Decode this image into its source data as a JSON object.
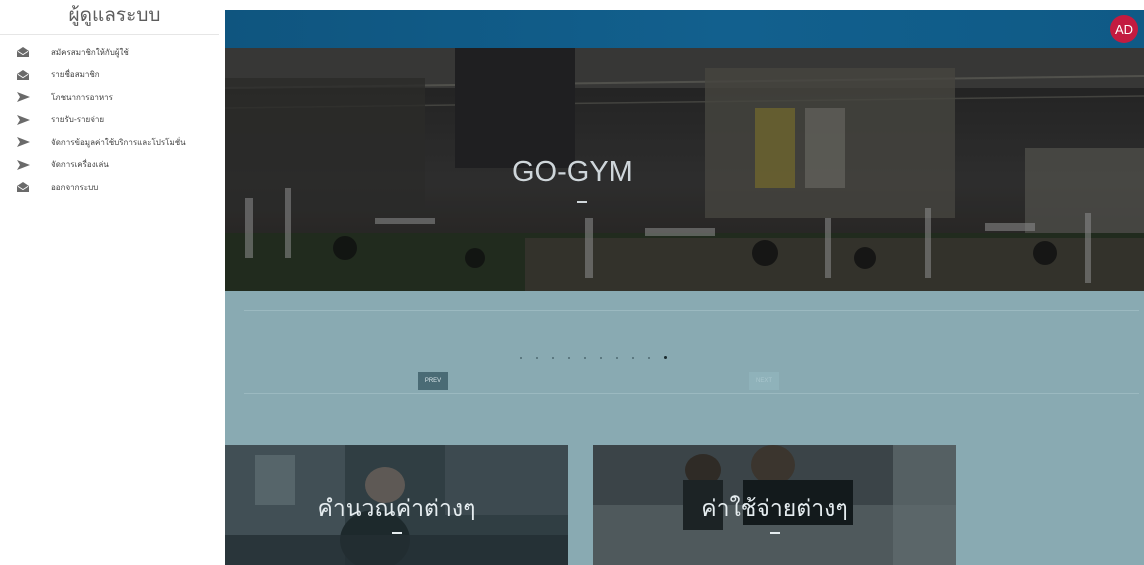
{
  "sidebar": {
    "title": "ผู้ดูแลระบบ",
    "items": [
      {
        "label": "สมัครสมาชิกให้กับผู้ใช้",
        "icon": "envelope-open-icon"
      },
      {
        "label": "รายชื่อสมาชิก",
        "icon": "envelope-open-icon"
      },
      {
        "label": "โภชนาการอาหาร",
        "icon": "send-icon"
      },
      {
        "label": "รายรับ-รายจ่าย",
        "icon": "send-icon"
      },
      {
        "label": "จัดการข้อมูลค่าใช้บริการและโปรโมชั่น",
        "icon": "send-icon"
      },
      {
        "label": "จัดการเครื่องเล่น",
        "icon": "send-icon"
      },
      {
        "label": "ออกจากระบบ",
        "icon": "envelope-open-icon"
      }
    ]
  },
  "header": {
    "avatar_initials": "AD",
    "avatar_color": "#c31b40",
    "bar_color": "#12608e"
  },
  "hero": {
    "title": "GO-GYM"
  },
  "carousel": {
    "prev_label": "PREV",
    "next_label": "NEXT",
    "dot_count": 10,
    "active_dot": 10
  },
  "cards": [
    {
      "title": "คำนวณค่าต่างๆ"
    },
    {
      "title": "ค่าใช้จ่ายต่างๆ"
    }
  ]
}
